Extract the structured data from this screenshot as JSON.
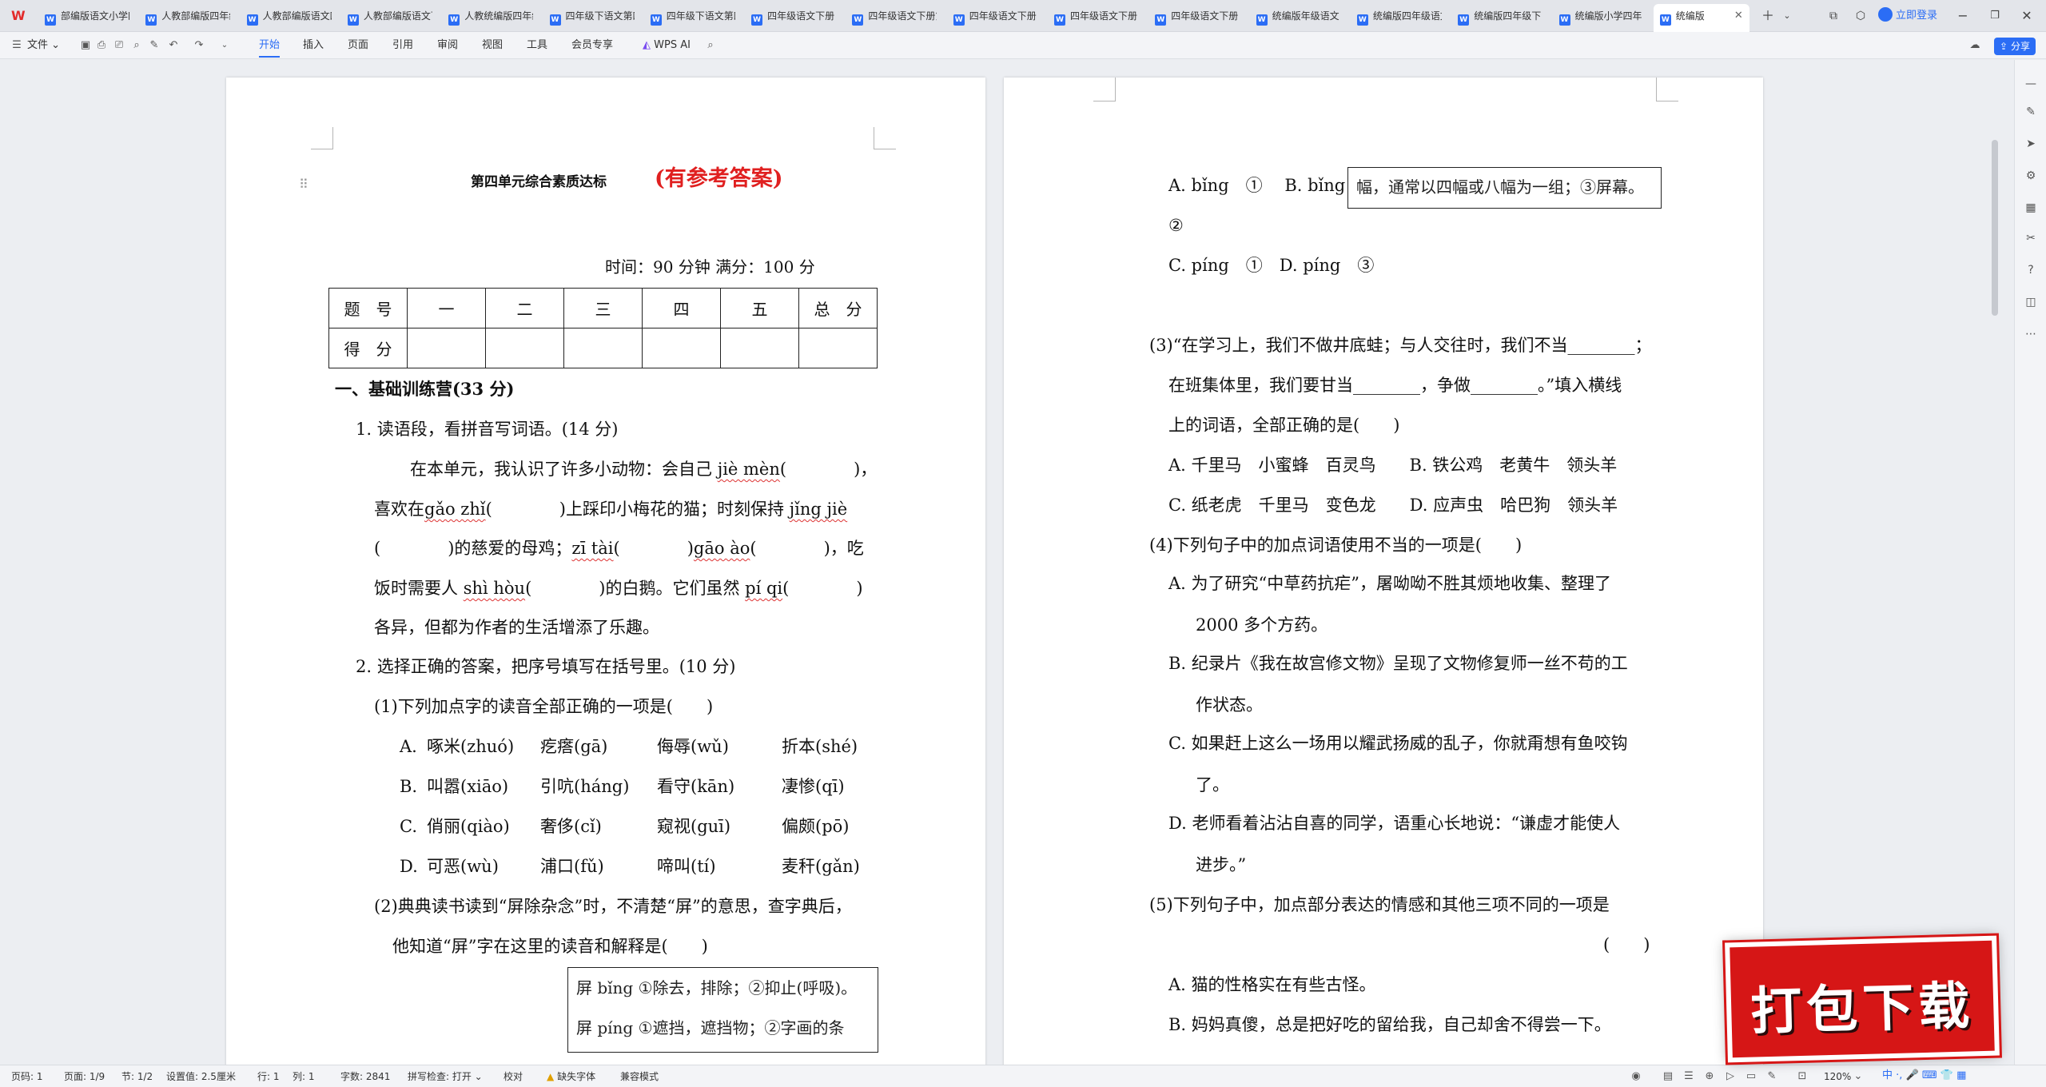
{
  "tabs": [
    {
      "label": "部编版语文小学四年级下册"
    },
    {
      "label": "人教部编版四年级下册"
    },
    {
      "label": "人教部编版语文四年级"
    },
    {
      "label": "人教部编版语文下册"
    },
    {
      "label": "人教统编版四年级"
    },
    {
      "label": "四年级下语文第四单元"
    },
    {
      "label": "四年级下语文第四"
    },
    {
      "label": "四年级语文下册"
    },
    {
      "label": "四年级语文下册第"
    },
    {
      "label": "四年级语文下册"
    },
    {
      "label": "四年级语文下册"
    },
    {
      "label": "四年级语文下册"
    },
    {
      "label": "统编版年级语文"
    },
    {
      "label": "统编版四年级语文"
    },
    {
      "label": "统编版四年级下"
    },
    {
      "label": "统编版小学四年"
    },
    {
      "label": "统编版"
    }
  ],
  "login_label": "立即登录",
  "menu": {
    "file": "文件",
    "items": [
      "开始",
      "插入",
      "页面",
      "引用",
      "审阅",
      "视图",
      "工具",
      "会员专享"
    ],
    "ai": "WPS AI"
  },
  "share_label": "分享",
  "page1": {
    "title": "第四单元综合素质达标",
    "title_note": "(有参考答案)",
    "time_line": "时间：90 分钟    满分：100 分",
    "table": {
      "header": [
        "题　号",
        "一",
        "二",
        "三",
        "四",
        "五",
        "总　分"
      ],
      "row2_label": "得　分"
    },
    "section1": "一、基础训练营(33 分)",
    "q1": "1. 读语段，看拼音写词语。(14 分)",
    "p1_l1a": "在本单元，我认识了许多小动物：会自己 ",
    "p1_l1b": "jiè mèn",
    "p1_l1c": "(　　　　)，",
    "p1_l2a": "喜欢在",
    "p1_l2b": "gǎo zhǐ",
    "p1_l2c": "(　　　　)上踩印小梅花的猫；时刻保持 ",
    "p1_l2d": "jǐng jiè",
    "p1_l3a": "(　　　　)的慈爱的母鸡；",
    "p1_l3b": "zī tài",
    "p1_l3c": "(　　　　)",
    "p1_l3d": "gāo ào",
    "p1_l3e": "(　　　　)，吃",
    "p1_l4a": "饭时需要人 ",
    "p1_l4b": "shì hòu",
    "p1_l4c": "(　　　　)的白鹅。它们虽然 ",
    "p1_l4d": "pí qi",
    "p1_l4e": "(　　　　)",
    "p1_l5": "各异，但都为作者的生活增添了乐趣。",
    "q2": "2. 选择正确的答案，把序号填写在括号里。(10 分)",
    "q2_1": "(1)下列加点字的读音全部正确的一项是(　　)",
    "options": [
      {
        "letter": "A. ",
        "cells": [
          "啄米(zhuó)",
          "疙瘩(gā)",
          "侮辱(wǔ)",
          "折本(shé)"
        ]
      },
      {
        "letter": "B. ",
        "cells": [
          "叫嚣(xiāo)",
          "引吭(háng)",
          "看守(kān)",
          "凄惨(qī)"
        ]
      },
      {
        "letter": "C. ",
        "cells": [
          "俏丽(qiào)",
          "奢侈(cǐ)",
          "窥视(guī)",
          "偏颇(pō)"
        ]
      },
      {
        "letter": "D. ",
        "cells": [
          "可恶(wù)",
          "浦口(fǔ)",
          "啼叫(tí)",
          "麦秆(gǎn)"
        ]
      }
    ],
    "q2_2a": "(2)典典读书读到“屏除杂念”时，不清楚“屏”的意思，查字典后，",
    "q2_2b": "他知道“屏”字在这里的读音和解释是(　　)",
    "dict1": "屏 bǐng ①除去，排除；②抑止(呼吸)。",
    "dict2": "屏 píng ①遮挡，遮挡物；②字画的条"
  },
  "page2": {
    "dict_cont": "幅，通常以四幅或八幅为一组；③屏幕。",
    "a_line": "A. bǐng　①　 B. bǐng",
    "circle2": "②",
    "c_line": "C. píng　①　D. píng　③",
    "q3a": "(3)“在学习上，我们不做井底蛙；与人交往时，我们不当________；",
    "q3b": "在班集体里，我们要甘当________，争做________。”填入横线",
    "q3c": "上的词语，全部正确的是(　　)",
    "q3_A": "A. 千里马　小蜜蜂　百灵鸟　　B. 铁公鸡　老黄牛　领头羊",
    "q3_C": "C. 纸老虎　千里马　变色龙　　D. 应声虫　哈巴狗　领头羊",
    "q4": "(4)下列句子中的加点词语使用不当的一项是(　　)",
    "q4_A1": "A. 为了研究“中草药抗疟”，屠呦呦不胜其烦地收集、整理了",
    "q4_A2": "2000 多个方药。",
    "q4_B1": "B. 纪录片《我在故宫修文物》呈现了文物修复师一丝不苟的工",
    "q4_B2": "作状态。",
    "q4_C1": "C. 如果赶上这么一场用以耀武扬威的乱子，你就甭想有鱼咬钩",
    "q4_C2": "了。",
    "q4_D1": "D. 老师看着沾沾自喜的同学，语重心长地说：“谦虚才能使人",
    "q4_D2": "进步。”",
    "q5a": "(5)下列句子中，加点部分表达的情感和其他三项不同的一项是",
    "q5b": "(　　)",
    "q5_A": "A. 猫的性格实在有些古怪。",
    "q5_B": "B. 妈妈真傻，总是把好吃的留给我，自己却舍不得尝一下。"
  },
  "status": {
    "page": "页码: 1",
    "pages": "页面: 1/9",
    "section": "节: 1/2",
    "setting": "设置值: 2.5厘米",
    "row": "行: 1",
    "col": "列: 1",
    "words": "字数: 2841",
    "spell": "拼写检查: 打开",
    "proof": "校对",
    "missing_font": "缺失字体",
    "compat": "兼容模式",
    "zoom": "120%"
  },
  "download_badge": "打包下载",
  "ime": "中 ·, 🎤 ⌨ 👕 ▦"
}
